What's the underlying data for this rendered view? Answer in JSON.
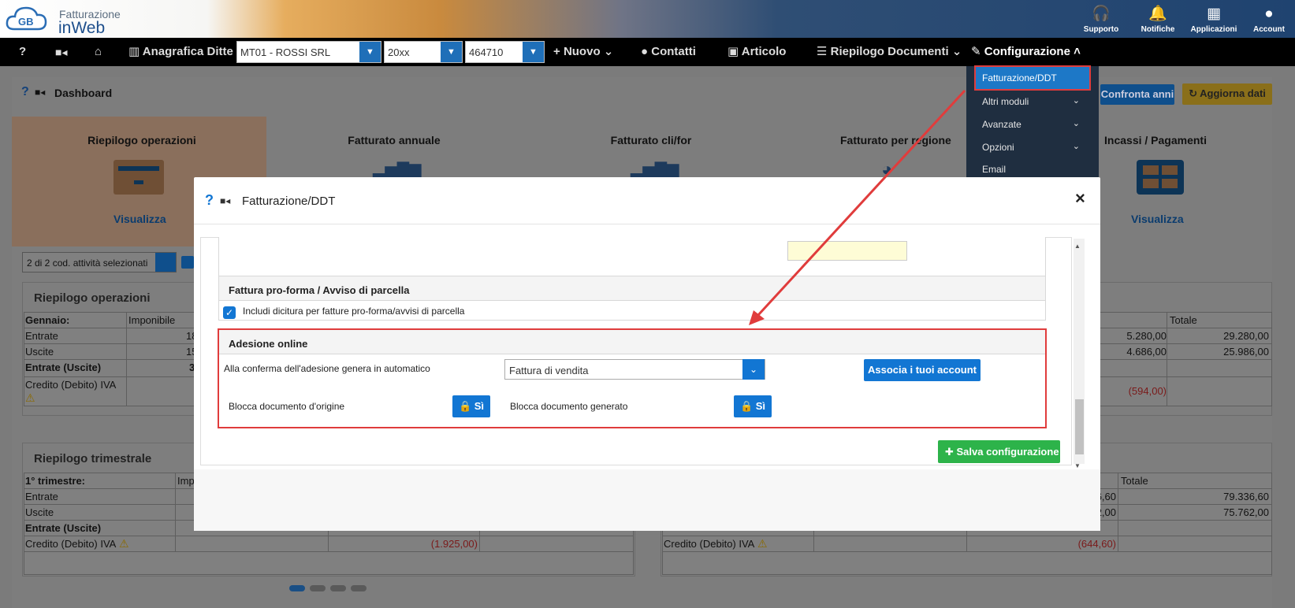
{
  "app": {
    "brand_line1": "Fatturazione",
    "brand_line2": "inWeb"
  },
  "top_actions": [
    {
      "label": "Supporto",
      "icon": "headset-icon"
    },
    {
      "label": "Notifiche",
      "icon": "bell-icon"
    },
    {
      "label": "Applicazioni",
      "icon": "grid-icon"
    },
    {
      "label": "Account",
      "icon": "user-circle-icon"
    }
  ],
  "navbar": {
    "help": "?",
    "anagrafica": "Anagrafica Ditte",
    "company": "MT01 - ROSSI SRL",
    "year": "20xx",
    "code": "464710",
    "nuovo": "Nuovo",
    "contatti": "Contatti",
    "articolo": "Articolo",
    "riepilogo_documenti": "Riepilogo Documenti",
    "configurazione": "Configurazione"
  },
  "config_menu": {
    "items": [
      {
        "label": "Fatturazione/DDT",
        "selected": true
      },
      {
        "label": "Altri moduli",
        "chevron": true
      },
      {
        "label": "Avanzate",
        "chevron": true
      },
      {
        "label": "Opzioni",
        "chevron": true
      },
      {
        "label": "Email"
      }
    ]
  },
  "dashboard": {
    "title": "Dashboard",
    "confronta": "Confronta anni",
    "aggiorna": "Aggiorna dati",
    "cards": [
      {
        "title": "Riepilogo operazioni",
        "link": "Visualizza"
      },
      {
        "title": "Fatturato annuale"
      },
      {
        "title": "Fatturato cli/for"
      },
      {
        "title": "Fatturato per regione"
      },
      {
        "title": "Incassi / Pagamenti",
        "link": "Visualizza"
      }
    ],
    "activity_select": "2 di 2 cod. attività selezionati",
    "riepilogo_operazioni": {
      "title": "Riepilogo operazioni",
      "month": "Gennaio:",
      "col_imponibile": "Imponibile",
      "col_totale": "Totale",
      "rows": [
        {
          "label": "Entrate",
          "left": "18",
          "iva": "5.280,00",
          "totale": "29.280,00"
        },
        {
          "label": "Uscite",
          "left": "15",
          "iva": "4.686,00",
          "totale": "25.986,00"
        },
        {
          "label": "Entrate (Uscite)",
          "left": "3",
          "iva": "",
          "totale": ""
        },
        {
          "label": "Credito (Debito) IVA",
          "left": "",
          "iva": "(594,00)",
          "totale": ""
        }
      ]
    },
    "riepilogo_trimestrale": {
      "title": "Riepilogo trimestrale",
      "period": "1° trimestre:",
      "col_imp": "Imp",
      "col_totale": "Totale",
      "rows": [
        {
          "label": "Entrate",
          "right_partial": "6,60",
          "totale": "79.336,60"
        },
        {
          "label": "Uscite",
          "right_partial": "2,00",
          "totale": "75.762,00"
        },
        {
          "label": "Entrate (Uscite)",
          "right_partial": "",
          "totale": ""
        },
        {
          "label": "Credito (Debito) IVA",
          "left_value": "(1.925,00)",
          "right_value": "(644,60)"
        }
      ]
    }
  },
  "modal": {
    "title": "Fatturazione/DDT",
    "close": "×",
    "proforma": {
      "title": "Fattura pro-forma / Avviso di parcella",
      "checkbox_label": "Includi dicitura per fatture pro-forma/avvisi di parcella",
      "checked": true
    },
    "adesione": {
      "title": "Adesione online",
      "auto_label": "Alla conferma dell'adesione genera in automatico",
      "auto_value": "Fattura di vendita",
      "associa": "Associa i tuoi account",
      "blocca_origine": "Blocca documento d'origine",
      "blocca_generato": "Blocca documento generato",
      "si": "Sì"
    },
    "save": "Salva configurazione"
  },
  "colors": {
    "accent": "#1276d3",
    "save": "#2db34a",
    "highlight": "#e03c3c",
    "navbar": "#000000"
  }
}
